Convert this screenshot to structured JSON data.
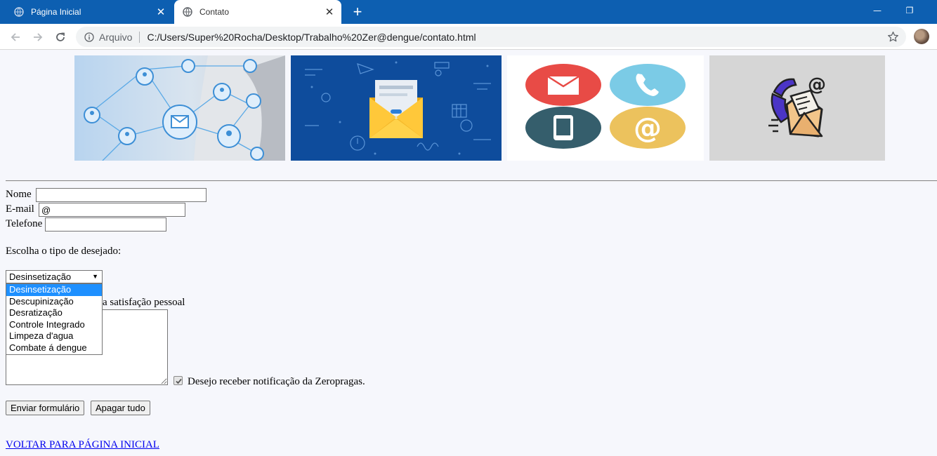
{
  "browser": {
    "tabs": [
      {
        "label": "Página Inicial",
        "active": false
      },
      {
        "label": "Contato",
        "active": true
      }
    ],
    "new_tab_label": "+",
    "close_label": "✕",
    "address": {
      "scheme_label": "Arquivo",
      "url": "C:/Users/Super%20Rocha/Desktop/Trabalho%20Zer@dengue/contato.html"
    },
    "window_controls": {
      "minimize": "—",
      "restore": "❐"
    }
  },
  "banner": {
    "images": [
      {
        "name": "network-email-image"
      },
      {
        "name": "envelope-illustration-image"
      },
      {
        "name": "contact-icons-image",
        "icon_at": "@"
      },
      {
        "name": "phone-mail-image",
        "icon_at": "@"
      }
    ]
  },
  "form": {
    "name_label": "Nome",
    "name_value": "",
    "email_label": "E-mail",
    "email_value": "@",
    "phone_label": "Telefone",
    "phone_value": "",
    "type_prompt": "Escolha o tipo de desejado:",
    "select_value": "Desinsetização",
    "select_options": [
      "Desinsetização",
      "Descupinização",
      "Desratização",
      "Controle Integrado",
      "Limpeza d'agua",
      "Combate á dengue"
    ],
    "message_label_partial": "a satisfação pessoal",
    "message_value": "",
    "notify_checked": true,
    "notify_label": "Desejo receber notificação da Zeropragas.",
    "submit_label": "Enviar formulário",
    "reset_label": "Apagar tudo"
  },
  "back_link": "VOLTAR PARA PÁGINA INICIAL",
  "colors": {
    "tabbar": "#0d5fb1",
    "page_bg": "#f6f7fc",
    "link": "#0000ee",
    "option_highlight": "#1e90ff"
  }
}
